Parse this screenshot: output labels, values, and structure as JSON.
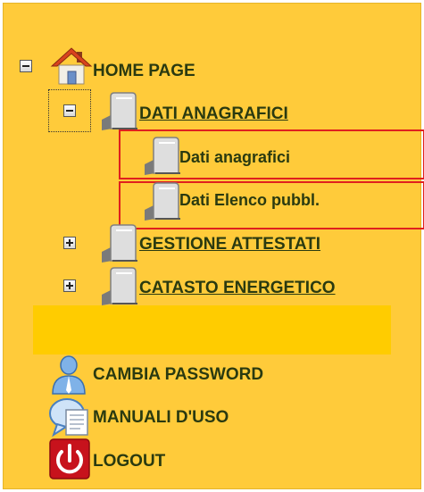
{
  "tree": {
    "home": {
      "label": "HOME PAGE",
      "icon": "home-icon",
      "expanded": true
    },
    "dati_anagrafici": {
      "label": "DATI ANAGRAFICI",
      "icon": "folder-icon",
      "expanded": true,
      "children": [
        {
          "label": "Dati anagrafici",
          "icon": "folder-icon"
        },
        {
          "label": "Dati Elenco pubbl.",
          "icon": "folder-icon"
        }
      ]
    },
    "gestione_attestati": {
      "label": "GESTIONE ATTESTATI",
      "icon": "folder-icon",
      "expanded": false
    },
    "catasto_energetico": {
      "label": "CATASTO ENERGETICO",
      "icon": "folder-icon",
      "expanded": false
    }
  },
  "actions": [
    {
      "label": "CAMBIA PASSWORD",
      "icon": "user-icon"
    },
    {
      "label": "MANUALI D'USO",
      "icon": "manual-chat-icon"
    },
    {
      "label": "LOGOUT",
      "icon": "power-icon"
    }
  ],
  "colors": {
    "panel_background": "#ffcb3a",
    "spacer_bar": "#ffcc00",
    "label_text": "#2a3a10",
    "selection_border": "#e0201e"
  }
}
